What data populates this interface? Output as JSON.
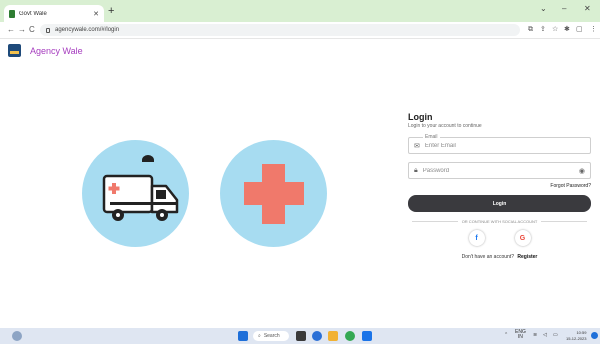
{
  "browser": {
    "tab_title": "Govt Wale",
    "new_tab": "+",
    "url": "agencywale.com/#/login",
    "window_controls": [
      "⌄",
      "–",
      "✕"
    ],
    "nav_back": "←",
    "nav_forward": "→",
    "nav_reload": "C",
    "toolbar_icons": [
      "⧉",
      "⇪",
      "☆",
      "✱",
      "▢",
      "⋮"
    ]
  },
  "site": {
    "brand_name": "Agency Wale"
  },
  "login": {
    "title": "Login",
    "subtitle": "Login to your account to continue",
    "email_legend": "Email",
    "email_placeholder": "Enter Email",
    "password_placeholder": "Password",
    "forgot_label": "Forgot Password?",
    "button_label": "Login",
    "divider_text": "OR CONTINUE WITH SOCIAL ACCOUNT",
    "facebook_glyph": "f",
    "google_glyph": "G",
    "register_prompt": "Don't have an account?",
    "register_link": "Register"
  },
  "taskbar": {
    "search_label": "Search",
    "lang_top": "ENG",
    "lang_bottom": "IN",
    "time": "10:59",
    "date": "15-12-2023"
  },
  "colors": {
    "brand": "#a63dbf",
    "circle_fill": "#a7dcf1",
    "cross_red": "#f0796b",
    "button_dark": "#3a3a3e",
    "chrome_green": "#d9efd2"
  }
}
